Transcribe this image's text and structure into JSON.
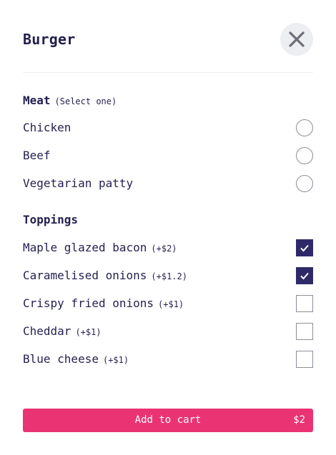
{
  "header": {
    "title": "Burger",
    "close_icon": "close-icon"
  },
  "meat": {
    "title": "Meat",
    "hint": "(Select one)",
    "options": [
      {
        "label": "Chicken",
        "price": "",
        "selected": false
      },
      {
        "label": "Beef",
        "price": "",
        "selected": false
      },
      {
        "label": "Vegetarian patty",
        "price": "",
        "selected": false
      }
    ]
  },
  "toppings": {
    "title": "Toppings",
    "options": [
      {
        "label": "Maple glazed bacon",
        "price": "(+$2)",
        "checked": true
      },
      {
        "label": "Caramelised onions",
        "price": "(+$1.2)",
        "checked": true
      },
      {
        "label": "Crispy fried onions",
        "price": "(+$1)",
        "checked": false
      },
      {
        "label": "Cheddar",
        "price": "(+$1)",
        "checked": false
      },
      {
        "label": "Blue cheese",
        "price": "(+$1)",
        "checked": false
      }
    ]
  },
  "cart": {
    "label": "Add to cart",
    "price": "$2"
  },
  "colors": {
    "accent": "#ea3373",
    "text": "#231f4f",
    "checkbox_checked": "#2f2a67",
    "close_bg": "#eceef2"
  }
}
